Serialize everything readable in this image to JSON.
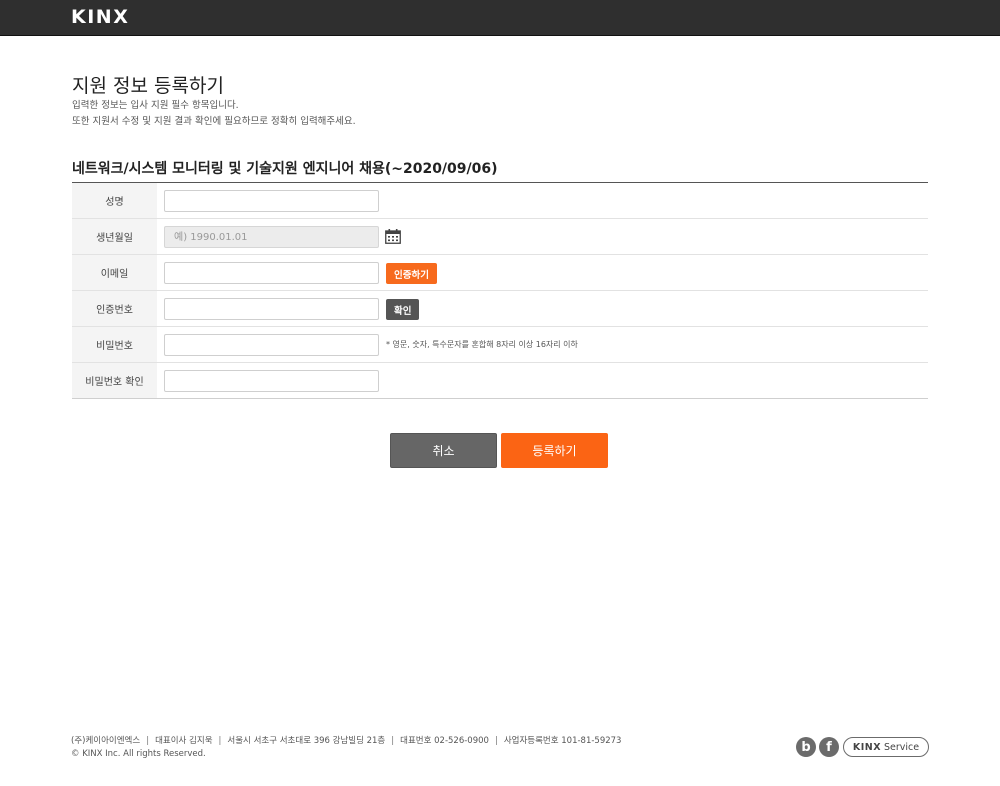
{
  "header": {
    "logo": "KINX"
  },
  "page": {
    "title": "지원 정보 등록하기",
    "intro_line1": "입력한 정보는 입사 지원 필수 항목입니다.",
    "intro_line2": "또한 지원서 수정 및 지원 결과 확인에 필요하므로 정확히 입력해주세요.",
    "job_title": "네트워크/시스템 모니터링 및 기술지원 엔지니어 채용(~2020/09/06)"
  },
  "form": {
    "name": {
      "label": "성명",
      "value": ""
    },
    "birth": {
      "label": "생년월일",
      "placeholder": "예) 1990.01.01"
    },
    "email": {
      "label": "이메일",
      "value": "",
      "button": "인증하기"
    },
    "code": {
      "label": "인증번호",
      "value": "",
      "button": "확인"
    },
    "password": {
      "label": "비밀번호",
      "value": "",
      "hint": "* 영문, 숫자, 특수문자를 혼합해 8자리 이상 16자리 이하"
    },
    "password_confirm": {
      "label": "비밀번호 확인",
      "value": ""
    }
  },
  "actions": {
    "cancel": "취소",
    "submit": "등록하기"
  },
  "footer": {
    "company": "(주)케이아이엔엑스",
    "ceo": "대표이사 김지욱",
    "address": "서울시 서초구 서초대로 396 강남빌딩 21층",
    "phone": "대표번호 02-526-0900",
    "biz_no": "사업자등록번호 101-81-59273",
    "copyright": "© KINX Inc. All rights Reserved.",
    "sep": "|",
    "social_blog": "b",
    "social_fb": "f",
    "service_brand": "KINX",
    "service_label": "Service"
  },
  "colors": {
    "accent": "#fb6414",
    "topbar": "#2f2f2f",
    "gray_button": "#555555"
  }
}
